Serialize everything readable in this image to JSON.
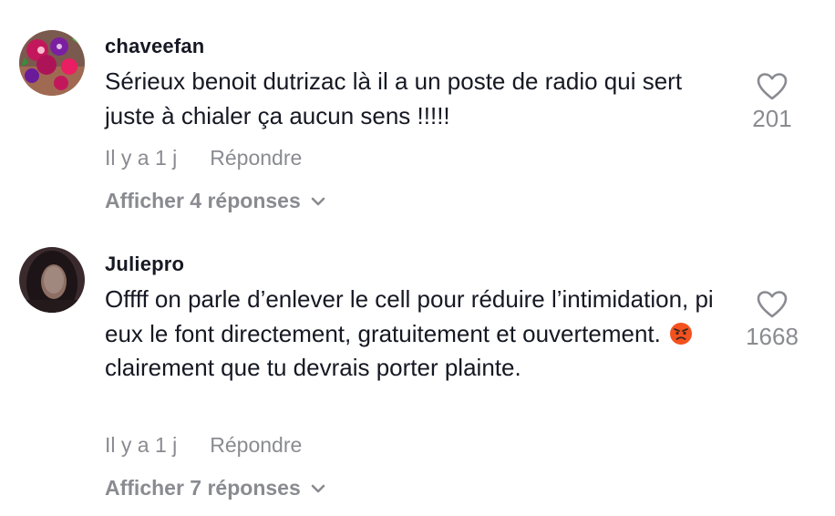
{
  "comments": [
    {
      "username": "chaveefan",
      "text": "Sérieux benoit dutrizac là il a un poste de radio qui sert juste à chialer ça aucun sens !!!!!",
      "time": "Il y a 1 j",
      "reply_label": "Répondre",
      "replies_label": "Afficher 4 réponses",
      "likes": "201",
      "avatar_icon": "flower-avatar"
    },
    {
      "username": "Juliepro",
      "text_before_emoji": "Offff on parle d’enlever le cell pour réduire l’intimidation, pi eux le font directement, gratuitement et ouvertement.",
      "emoji": "angry-face-emoji",
      "text_after_emoji": "clairement que tu devrais porter plainte.",
      "time": "Il y a 1 j",
      "reply_label": "Répondre",
      "replies_label": "Afficher 7 réponses",
      "likes": "1668",
      "avatar_icon": "portrait-avatar"
    }
  ],
  "colors": {
    "primary_text": "#161823",
    "secondary_text": "#8a8b91"
  }
}
